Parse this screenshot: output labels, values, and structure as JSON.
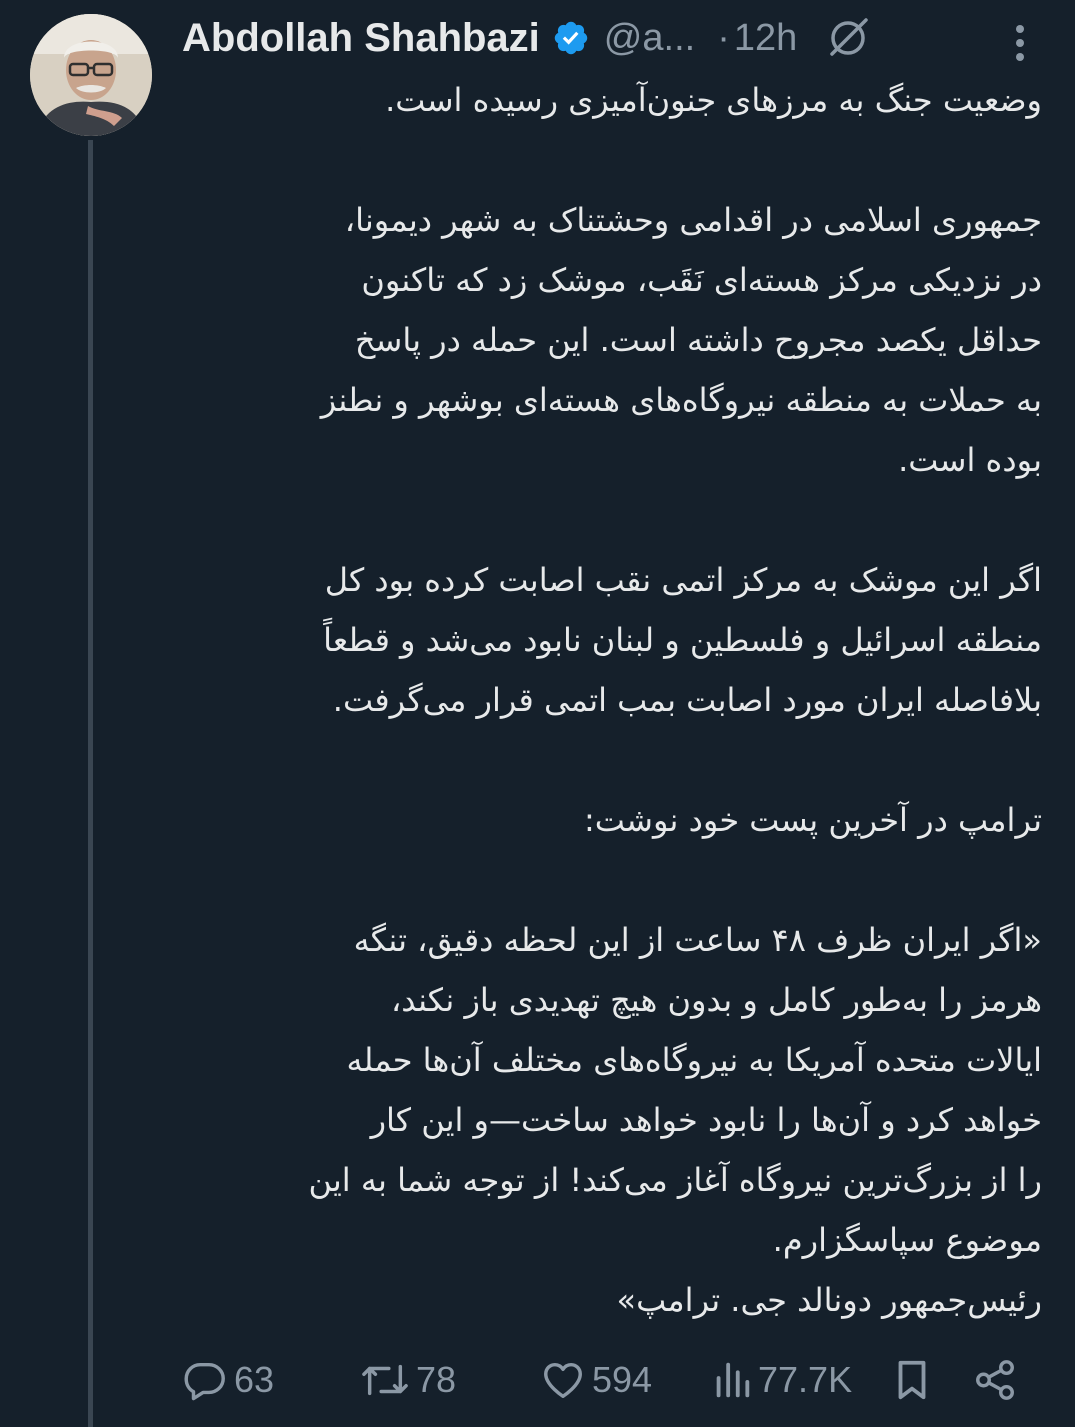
{
  "author": {
    "name": "Abdollah Shahbazi",
    "handle": "@a...",
    "separator": "·",
    "time": "12h"
  },
  "icons": {
    "verified": "verified-badge-icon",
    "muted": "nosign-icon",
    "more": "more-vertical-icon",
    "reply": "reply-icon",
    "retweet": "retweet-icon",
    "like": "heart-icon",
    "views": "views-icon",
    "bookmark": "bookmark-icon",
    "share": "share-icon"
  },
  "colors": {
    "background": "#15202b",
    "text": "#e7e9ea",
    "muted": "#8b98a5",
    "verified": "#1d9bf0"
  },
  "tweet": {
    "paragraph1": [
      "وضعیت جنگ به مرزهای جنون‌آمیزی رسیده است."
    ],
    "paragraph2": [
      "جمهوری اسلامی در اقدامی وحشتناک به شهر دیمونا،",
      "در نزدیکی مرکز هسته‌ای نَقَب، موشک زد که تاکنون",
      "حداقل یکصد مجروح داشته است. این حمله در پاسخ",
      "به حملات به منطقه نیروگاه‌های هسته‌ای بوشهر و نطنز",
      "بوده است."
    ],
    "paragraph3": [
      "اگر این موشک به مرکز اتمی نقب اصابت کرده بود کل",
      "منطقه اسرائیل و فلسطین و لبنان نابود می‌شد و قطعاً",
      "بلافاصله ایران مورد اصابت بمب اتمی قرار می‌گرفت."
    ],
    "paragraph4": [
      "ترامپ در آخرین پست خود نوشت:"
    ],
    "paragraph5": [
      "«اگر ایران ظرف ۴۸ ساعت از این لحظه دقیق، تنگه",
      "هرمز را به‌طور کامل و بدون هیچ تهدیدی باز نکند،",
      "ایالات متحده آمریکا به نیروگاه‌های مختلف آن‌ها حمله",
      "خواهد کرد و آن‌ها را نابود خواهد ساخت—و این کار",
      "را از بزرگ‌ترین نیروگاه آغاز می‌کند! از توجه شما به این",
      "موضوع سپاسگزارم.",
      "رئیس‌جمهور دونالد جی. ترامپ»"
    ]
  },
  "stats": {
    "replies": "63",
    "retweets": "78",
    "likes": "594",
    "views": "77.7K"
  }
}
